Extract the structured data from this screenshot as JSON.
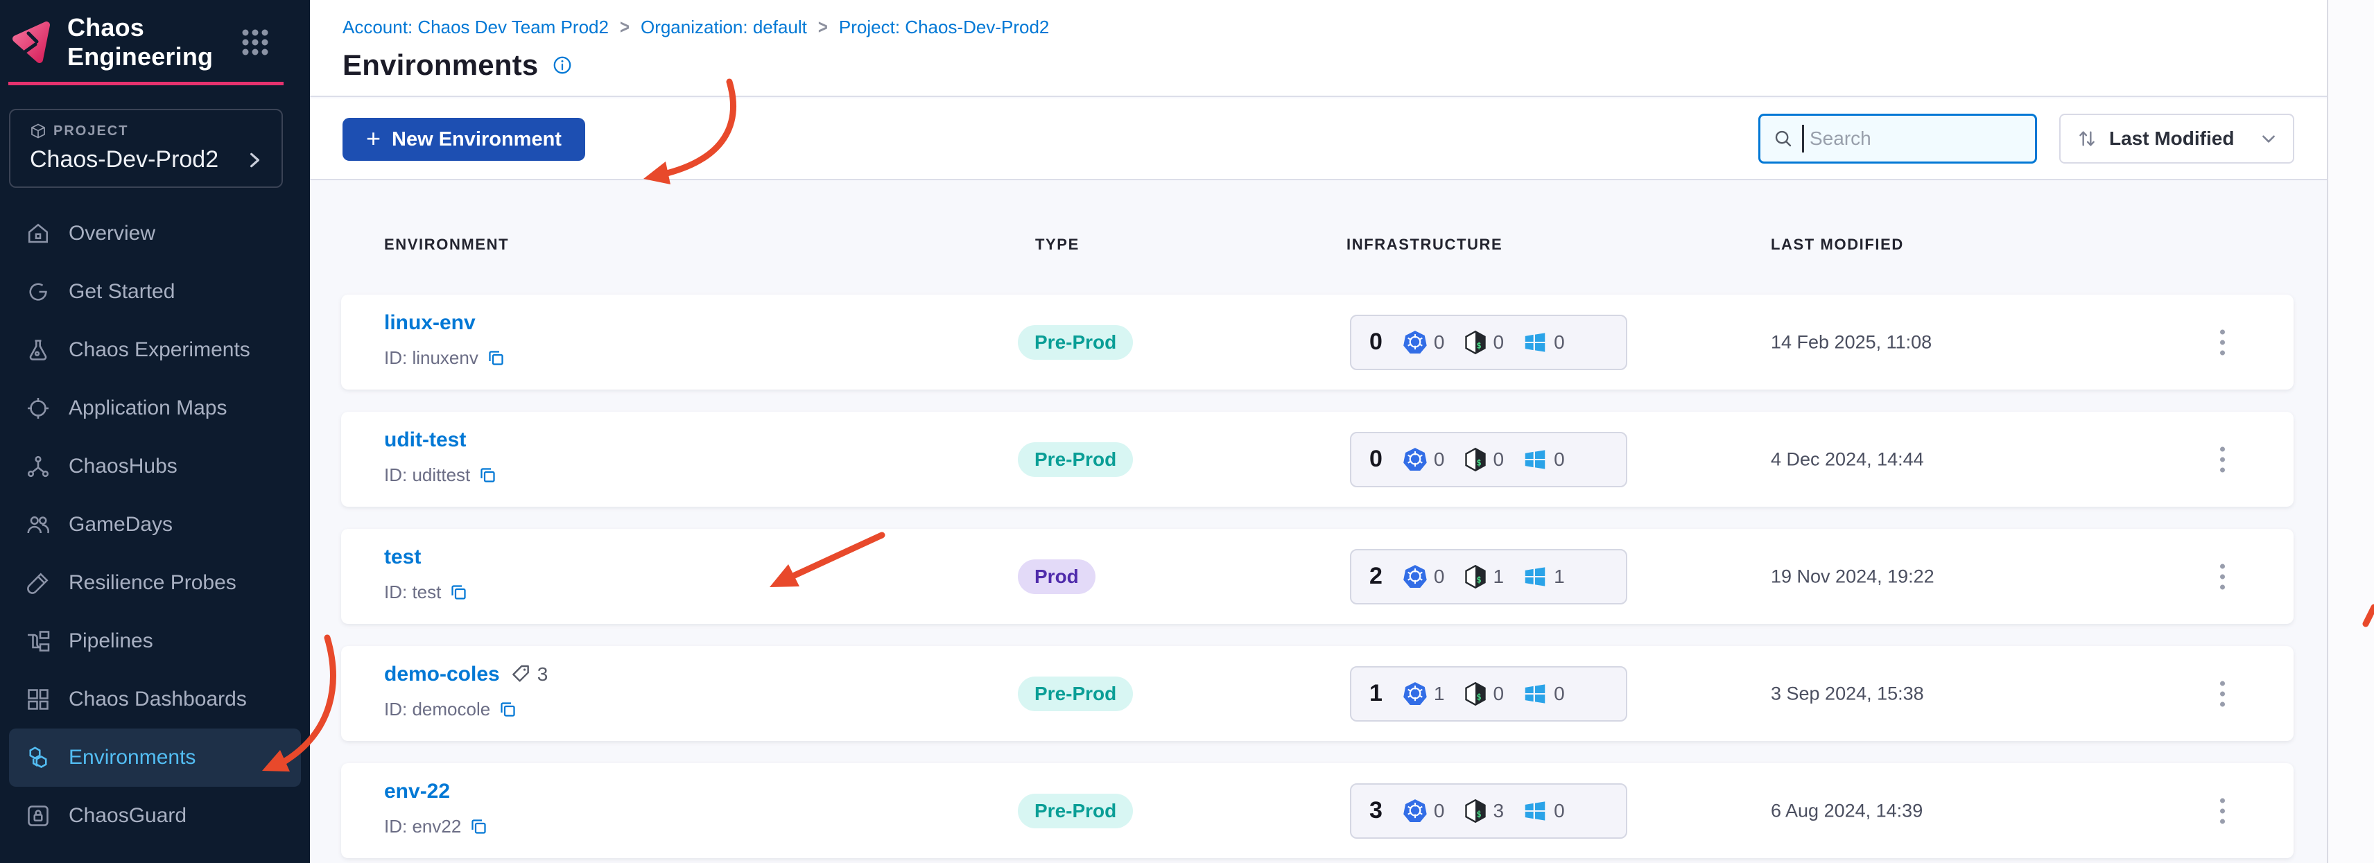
{
  "app": {
    "product_title": "Chaos Engineering"
  },
  "sidebar": {
    "project_label": "PROJECT",
    "project_name": "Chaos-Dev-Prod2",
    "items": [
      {
        "label": "Overview"
      },
      {
        "label": "Get Started"
      },
      {
        "label": "Chaos Experiments"
      },
      {
        "label": "Application Maps"
      },
      {
        "label": "ChaosHubs"
      },
      {
        "label": "GameDays"
      },
      {
        "label": "Resilience Probes"
      },
      {
        "label": "Pipelines"
      },
      {
        "label": "Chaos Dashboards"
      },
      {
        "label": "Environments"
      },
      {
        "label": "ChaosGuard"
      }
    ]
  },
  "breadcrumb": {
    "account": "Account: Chaos Dev Team Prod2",
    "org": "Organization: default",
    "project": "Project: Chaos-Dev-Prod2",
    "separator": ">"
  },
  "page": {
    "title": "Environments"
  },
  "toolbar": {
    "new_button_plus": "+",
    "new_button_label": "New Environment",
    "search_placeholder": "Search",
    "sort_label": "Last Modified"
  },
  "table": {
    "headers": {
      "environment": "ENVIRONMENT",
      "type": "TYPE",
      "infrastructure": "INFRASTRUCTURE",
      "last_modified": "LAST MODIFIED"
    },
    "rows": [
      {
        "name": "linux-env",
        "id": "ID: linuxenv",
        "type": "Pre-Prod",
        "total": "0",
        "k8s": "0",
        "linux": "0",
        "windows": "0",
        "modified": "14 Feb 2025, 11:08"
      },
      {
        "name": "udit-test",
        "id": "ID: udittest",
        "type": "Pre-Prod",
        "total": "0",
        "k8s": "0",
        "linux": "0",
        "windows": "0",
        "modified": "4 Dec 2024, 14:44"
      },
      {
        "name": "test",
        "id": "ID: test",
        "type": "Prod",
        "total": "2",
        "k8s": "0",
        "linux": "1",
        "windows": "1",
        "modified": "19 Nov 2024, 19:22"
      },
      {
        "name": "demo-coles",
        "id": "ID: democole",
        "tags": "3",
        "type": "Pre-Prod",
        "total": "1",
        "k8s": "1",
        "linux": "0",
        "windows": "0",
        "modified": "3 Sep 2024, 15:38"
      },
      {
        "name": "env-22",
        "id": "ID: env22",
        "type": "Pre-Prod",
        "total": "3",
        "k8s": "0",
        "linux": "3",
        "windows": "0",
        "modified": "6 Aug 2024, 14:39"
      }
    ]
  },
  "colors": {
    "accent_pink": "#e5326e",
    "primary_blue": "#0278d5",
    "button_blue": "#1d4fb2",
    "sidebar_bg": "#0d1b2e",
    "preprod_badge_text": "#0a9e96",
    "prod_badge_text": "#4f2bab",
    "annotation_red": "#e8492b"
  }
}
